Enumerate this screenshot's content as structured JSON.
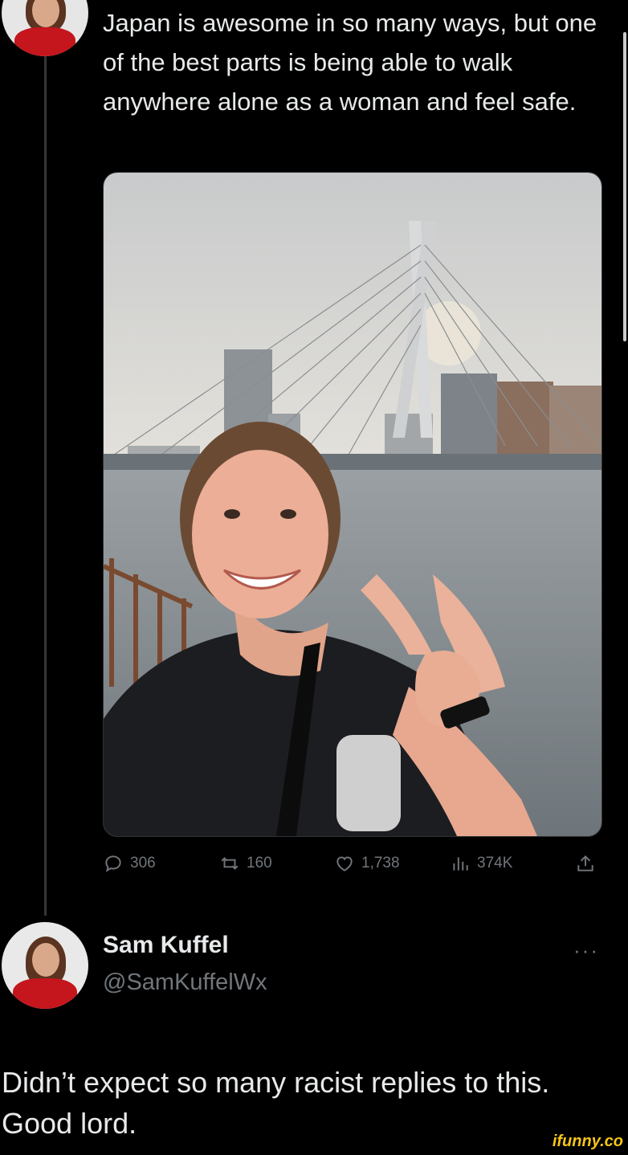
{
  "tweet": {
    "text": "Japan is awesome in so many ways, but one of the best parts is being able to walk anywhere alone as a woman and feel safe.",
    "stats": {
      "replies": "306",
      "retweets": "160",
      "likes": "1,738",
      "views": "374K"
    }
  },
  "reply": {
    "name": "Sam Kuffel",
    "handle": "@SamKuffelWx",
    "text": "Didn’t expect so many racist replies to this. Good lord.",
    "more_label": "···"
  },
  "watermark": "ifunny.co",
  "colors": {
    "background": "#000000",
    "text": "#e7e9ea",
    "muted": "#71767b",
    "thread_line": "#333639",
    "watermark": "#f5c518"
  },
  "icons": [
    "reply-icon",
    "retweet-icon",
    "like-icon",
    "views-icon",
    "share-icon",
    "more-icon"
  ]
}
